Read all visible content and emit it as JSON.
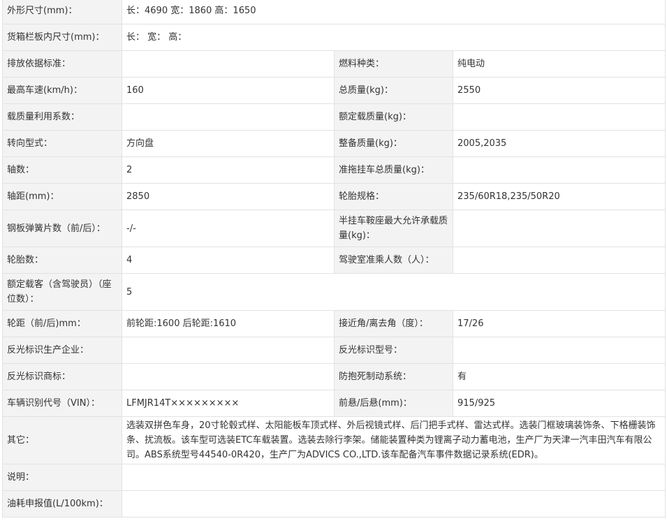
{
  "rows": [
    {
      "label": "外形尺寸(mm)：",
      "value": "长：4690 宽：1860 高：1650"
    },
    {
      "label": "货箱栏板内尺寸(mm)：",
      "value": "长： 宽： 高："
    },
    {
      "label": "排放依据标准：",
      "value": "",
      "label2": "燃料种类：",
      "value2": "纯电动"
    },
    {
      "label": "最高车速(km/h)：",
      "value": "160",
      "label2": "总质量(kg)：",
      "value2": "2550"
    },
    {
      "label": "载质量利用系数：",
      "value": "",
      "label2": "额定载质量(kg)：",
      "value2": ""
    },
    {
      "label": "转向型式：",
      "value": "方向盘",
      "label2": "整备质量(kg)：",
      "value2": "2005,2035"
    },
    {
      "label": "轴数：",
      "value": "2",
      "label2": "准拖挂车总质量(kg)：",
      "value2": ""
    },
    {
      "label": "轴距(mm)：",
      "value": "2850",
      "label2": "轮胎规格：",
      "value2": "235/60R18,235/50R20"
    },
    {
      "label": "钢板弹簧片数（前/后）：",
      "value": "-/-",
      "label2": "半挂车鞍座最大允许承载质量(kg)：",
      "value2": ""
    },
    {
      "label": "轮胎数：",
      "value": "4",
      "label2": "驾驶室准乘人数（人）：",
      "value2": ""
    },
    {
      "label": "额定载客（含驾驶员）（座位数）：",
      "value": "5"
    },
    {
      "label": "轮距（前/后)mm：",
      "value": "前轮距:1600 后轮距:1610",
      "label2": "接近角/离去角（度）：",
      "value2": "17/26"
    },
    {
      "label": "反光标识生产企业：",
      "value": "",
      "label2": "反光标识型号：",
      "value2": ""
    },
    {
      "label": "反光标识商标：",
      "value": "",
      "label2": "防抱死制动系统：",
      "value2": "有"
    },
    {
      "label": "车辆识别代号（VIN）：",
      "value": "LFMJR14T×××××××××",
      "label2": "前悬/后悬(mm)：",
      "value2": "915/925"
    },
    {
      "label": "其它：",
      "value": "选装双拼色车身，20寸轮毂式样、太阳能板车顶式样、外后视镜式样、后门把手式样、雷达式样。选装门框玻璃装饰条、下格栅装饰条、扰流板。该车型可选装ETC车载装置。选装去除行李架。储能装置种类为锂离子动力蓄电池，生产厂为天津一汽丰田汽车有限公司。ABS系统型号44540-0R420，生产厂为ADVICS CO.,LTD.该车配备汽车事件数据记录系统(EDR)。"
    },
    {
      "label": "说明：",
      "value": ""
    },
    {
      "label": "油耗申报值(L/100km)：",
      "value": ""
    }
  ]
}
